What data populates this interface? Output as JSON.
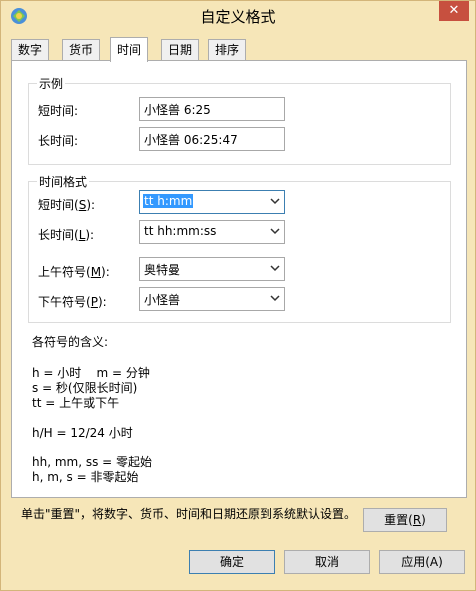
{
  "window": {
    "title": "自定义格式",
    "close": "✕"
  },
  "tabs": [
    "数字",
    "货币",
    "时间",
    "日期",
    "排序"
  ],
  "samples": {
    "group_title": "示例",
    "short_label": "短时间:",
    "short_value": "小怪兽 6:25",
    "long_label": "长时间:",
    "long_value": "小怪兽 06:25:47"
  },
  "formats": {
    "group_title": "时间格式",
    "short_label_pre": "短时间(",
    "short_label_key": "S",
    "short_label_post": "):",
    "short_value": "tt h:mm",
    "long_label_pre": "长时间(",
    "long_label_key": "L",
    "long_label_post": "):",
    "long_value": "tt hh:mm:ss",
    "am_label_pre": "上午符号(",
    "am_label_key": "M",
    "am_label_post": "):",
    "am_value": "奥特曼",
    "pm_label_pre": "下午符号(",
    "pm_label_key": "P",
    "pm_label_post": "):",
    "pm_value": "小怪兽"
  },
  "legend": {
    "heading": "各符号的含义:",
    "lines": [
      "h = 小时    m = 分钟",
      "s = 秒(仅限长时间)",
      "tt = 上午或下午",
      "",
      "h/H = 12/24 小时",
      "",
      "hh, mm, ss = 零起始",
      "h, m, s = 非零起始"
    ]
  },
  "reset": {
    "note_line1": "单击\"重置\"，将数字、货币、时间和日期还原到系统默认设置。",
    "button_pre": "重置(",
    "button_key": "R",
    "button_post": ")"
  },
  "footer": {
    "ok": "确定",
    "cancel": "取消",
    "apply": "应用(A)"
  }
}
